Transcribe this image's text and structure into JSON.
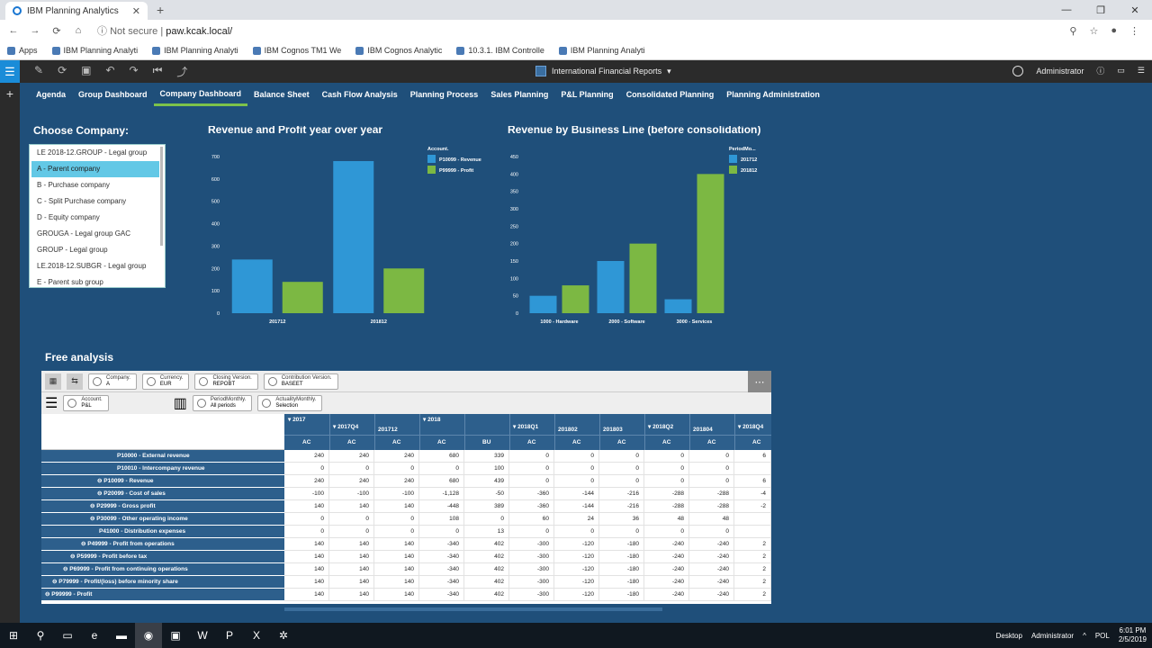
{
  "browser": {
    "tab_title": "IBM Planning Analytics",
    "url_prefix": "Not secure",
    "url": "paw.kcak.local/",
    "bookmarks": [
      "Apps",
      "IBM Planning Analyti",
      "IBM Planning Analyti",
      "IBM Cognos TM1 We",
      "IBM Cognos Analytic",
      "10.3.1. IBM Controlle",
      "IBM Planning Analyti"
    ]
  },
  "toolbar": {
    "book_title": "International Financial Reports",
    "user": "Administrator"
  },
  "tabs": [
    "Agenda",
    "Group Dashboard",
    "Company Dashboard",
    "Balance Sheet",
    "Cash Flow Analysis",
    "Planning Process",
    "Sales Planning",
    "P&L Planning",
    "Consolidated Planning",
    "Planning Administration"
  ],
  "active_tab": "Company Dashboard",
  "choose": {
    "title": "Choose Company:",
    "items": [
      "LE 2018-12.GROUP - Legal group",
      "A - Parent company",
      "B - Purchase company",
      "C - Split Purchase company",
      "D - Equity company",
      "GROUGA - Legal group GAC",
      "GROUP - Legal group",
      "LE.2018-12.SUBGR - Legal group",
      "E - Parent sub group"
    ],
    "selected": "A - Parent company"
  },
  "chart_data": [
    {
      "type": "bar",
      "title": "Revenue and Profit year over year",
      "categories": [
        "201712",
        "201812"
      ],
      "legend_title": "Account.",
      "series": [
        {
          "name": "P10099 - Revenue",
          "color": "#2f97d6",
          "values": [
            240,
            680
          ]
        },
        {
          "name": "P99999 - Profit",
          "color": "#7cb843",
          "values": [
            140,
            200
          ]
        }
      ],
      "ylim": [
        0,
        700
      ],
      "yticks": [
        0,
        100,
        200,
        300,
        400,
        500,
        600,
        700
      ]
    },
    {
      "type": "bar",
      "title": "Revenue by Business Line (before consolidation)",
      "categories": [
        "1000 - Hardware",
        "2000 - Software",
        "3000 - Services"
      ],
      "legend_title": "PeriodMo...",
      "series": [
        {
          "name": "201712",
          "color": "#2f97d6",
          "values": [
            50,
            150,
            40
          ]
        },
        {
          "name": "201812",
          "color": "#7cb843",
          "values": [
            80,
            200,
            400
          ]
        }
      ],
      "ylim": [
        0,
        450
      ],
      "yticks": [
        0,
        50,
        100,
        150,
        200,
        250,
        300,
        350,
        400,
        450
      ]
    }
  ],
  "free_analysis": {
    "title": "Free analysis",
    "context": [
      {
        "dim": "Company",
        "val": "A"
      },
      {
        "dim": "Currency",
        "val": "EUR"
      },
      {
        "dim": "Closing Version",
        "val": "REPOBT"
      },
      {
        "dim": "Contribution Version",
        "val": "BASEET"
      }
    ],
    "rows_dim": {
      "dim": "Account",
      "val": "P&L"
    },
    "cols_dims": [
      {
        "dim": "PeriodMonthly",
        "val": "All periods"
      },
      {
        "dim": "ActualityMonthly",
        "val": "Selection"
      }
    ],
    "col_periods": [
      "2017",
      "2017Q4",
      "201712",
      "2018",
      "2018Q1",
      "201802",
      "201803",
      "2018Q2",
      "201804",
      "2018Q4"
    ],
    "col_actuality": [
      "AC",
      "AC",
      "AC",
      "AC",
      "BU",
      "AC",
      "AC",
      "AC",
      "AC",
      "AC",
      "AC"
    ],
    "rows": [
      {
        "label": "P10000 - External revenue",
        "values": [
          "240",
          "240",
          "240",
          "680",
          "339",
          "0",
          "0",
          "0",
          "0",
          "0",
          "6"
        ]
      },
      {
        "label": "P10010 - Intercompany revenue",
        "values": [
          "0",
          "0",
          "0",
          "0",
          "100",
          "0",
          "0",
          "0",
          "0",
          "0",
          ""
        ]
      },
      {
        "label": "P10099 - Revenue",
        "values": [
          "240",
          "240",
          "240",
          "680",
          "439",
          "0",
          "0",
          "0",
          "0",
          "0",
          "6"
        ]
      },
      {
        "label": "P20099 - Cost of sales",
        "values": [
          "-100",
          "-100",
          "-100",
          "-1,128",
          "-50",
          "-360",
          "-144",
          "-216",
          "-288",
          "-288",
          "-4"
        ]
      },
      {
        "label": "P29999 - Gross profit",
        "values": [
          "140",
          "140",
          "140",
          "-448",
          "389",
          "-360",
          "-144",
          "-216",
          "-288",
          "-288",
          "-2"
        ]
      },
      {
        "label": "P30099 - Other operating income",
        "values": [
          "0",
          "0",
          "0",
          "108",
          "0",
          "60",
          "24",
          "36",
          "48",
          "48",
          ""
        ]
      },
      {
        "label": "P41000 - Distribution expenses",
        "values": [
          "0",
          "0",
          "0",
          "0",
          "13",
          "0",
          "0",
          "0",
          "0",
          "0",
          ""
        ]
      },
      {
        "label": "P49999 - Profit from operations",
        "values": [
          "140",
          "140",
          "140",
          "-340",
          "402",
          "-300",
          "-120",
          "-180",
          "-240",
          "-240",
          "2"
        ]
      },
      {
        "label": "P59999 - Profit before tax",
        "values": [
          "140",
          "140",
          "140",
          "-340",
          "402",
          "-300",
          "-120",
          "-180",
          "-240",
          "-240",
          "2"
        ]
      },
      {
        "label": "P69999 - Profit from continuing operations",
        "values": [
          "140",
          "140",
          "140",
          "-340",
          "402",
          "-300",
          "-120",
          "-180",
          "-240",
          "-240",
          "2"
        ]
      },
      {
        "label": "P79999 - Profit/(loss) before minority share",
        "values": [
          "140",
          "140",
          "140",
          "-340",
          "402",
          "-300",
          "-120",
          "-180",
          "-240",
          "-240",
          "2"
        ]
      },
      {
        "label": "P99999 - Profit",
        "values": [
          "140",
          "140",
          "140",
          "-340",
          "402",
          "-300",
          "-120",
          "-180",
          "-240",
          "-240",
          "2"
        ]
      }
    ]
  },
  "taskbar": {
    "desktop_label": "Desktop",
    "user": "Administrator",
    "lang": "POL",
    "time": "6:01 PM",
    "date": "2/5/2019"
  }
}
